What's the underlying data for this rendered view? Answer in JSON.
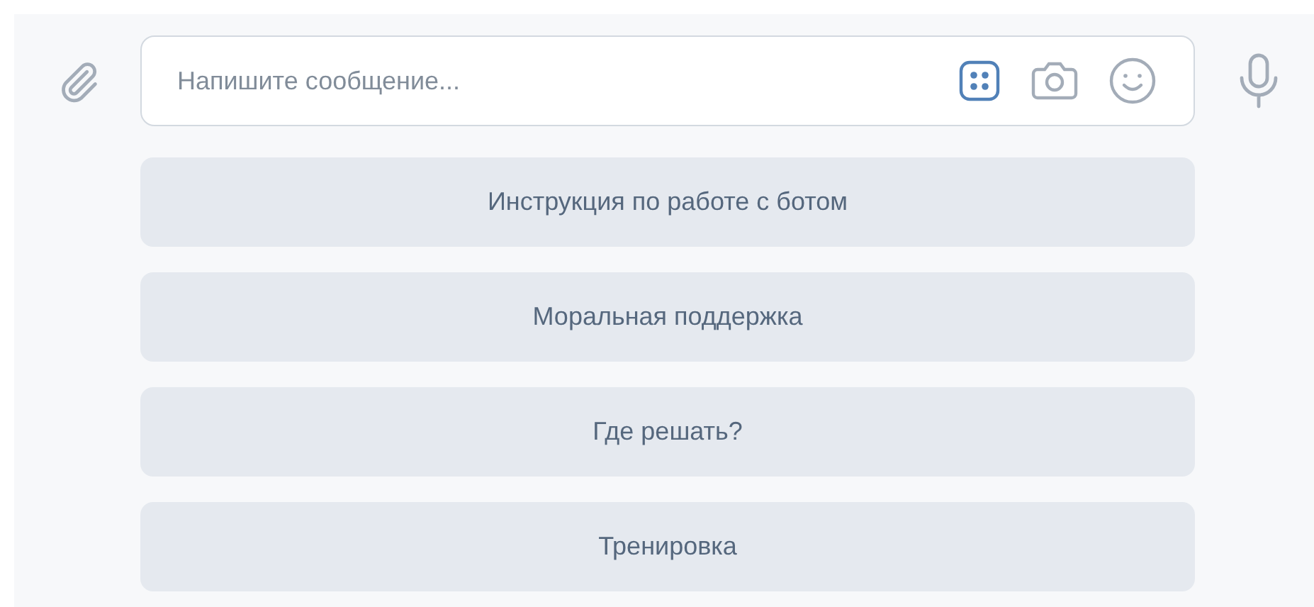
{
  "composer": {
    "placeholder": "Напишите сообщение...",
    "bot_keyboard_active": true
  },
  "keyboard_buttons": [
    {
      "label": "Инструкция по работе с ботом"
    },
    {
      "label": "Моральная поддержка"
    },
    {
      "label": "Где решать?"
    },
    {
      "label": "Тренировка"
    }
  ]
}
